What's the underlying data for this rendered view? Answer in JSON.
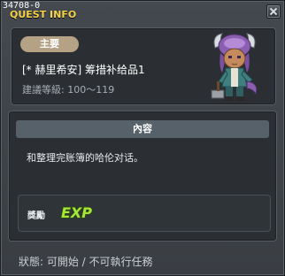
{
  "window": {
    "id_label": "34708-0",
    "title": "QUEST INFO"
  },
  "quest": {
    "badge": "主要",
    "name": "[* 赫里希安] 筹措补给品1",
    "level_text": "建議等級: 100～119"
  },
  "content": {
    "header": "內容",
    "description": "和整理完账簿的哈伦对话。",
    "reward_label": "獎勵",
    "reward_icon": "exp-icon",
    "reward_icon_text": "EXP"
  },
  "status": {
    "text": "狀態: 可開始 / 不可執行任務"
  },
  "colors": {
    "title": "#f4d24a",
    "badge": "#b5a285",
    "section_header": "#566169",
    "exp": "#a6e63a"
  }
}
